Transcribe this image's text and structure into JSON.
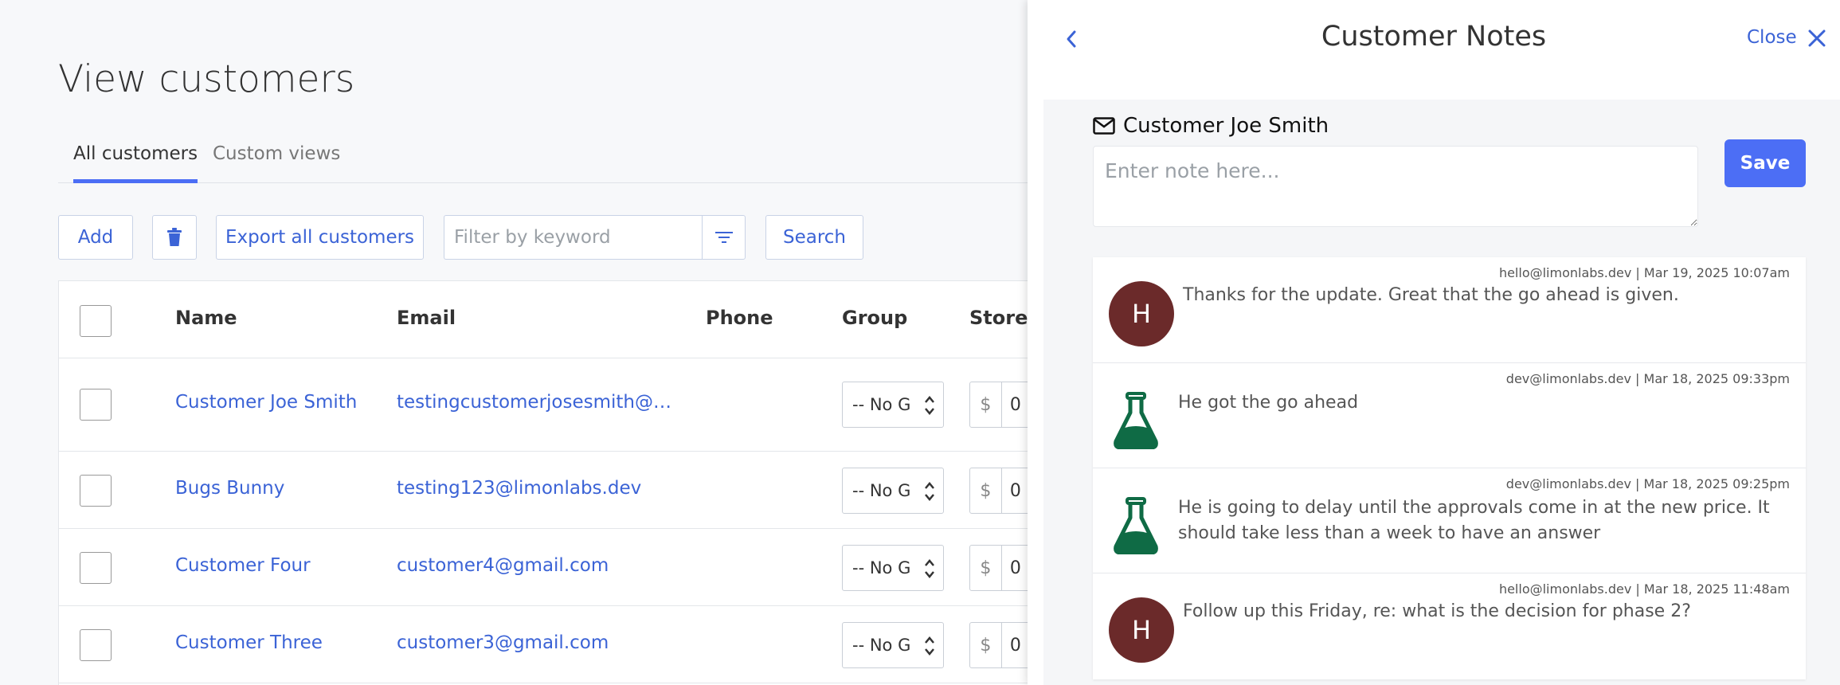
{
  "page": {
    "title": "View customers",
    "tabs": [
      {
        "label": "All customers",
        "active": true
      },
      {
        "label": "Custom views",
        "active": false
      }
    ],
    "toolbar": {
      "add_label": "Add",
      "delete_icon": "trash-icon",
      "export_label": "Export all customers",
      "filter_placeholder": "Filter by keyword",
      "filter_icon": "filter-icon",
      "search_label": "Search"
    },
    "table": {
      "columns": [
        "Name",
        "Email",
        "Phone",
        "Group",
        "Store c"
      ],
      "rows": [
        {
          "name": "Customer Joe Smith",
          "email": "testingcustomerjosesmith@limo...",
          "phone": "",
          "group": "-- No Gr",
          "currency": "$",
          "credit": "0"
        },
        {
          "name": "Bugs Bunny",
          "email": "testing123@limonlabs.dev",
          "phone": "",
          "group": "-- No Gr",
          "currency": "$",
          "credit": "0"
        },
        {
          "name": "Customer Four",
          "email": "customer4@gmail.com",
          "phone": "",
          "group": "-- No Gr",
          "currency": "$",
          "credit": "0"
        },
        {
          "name": "Customer Three",
          "email": "customer3@gmail.com",
          "phone": "",
          "group": "-- No Gr",
          "currency": "$",
          "credit": "0"
        }
      ]
    }
  },
  "notes_panel": {
    "title": "Customer Notes",
    "close_label": "Close",
    "customer_label": "Customer Joe Smith",
    "note_placeholder": "Enter note here...",
    "save_label": "Save",
    "notes": [
      {
        "author": "hello@limonlabs.dev",
        "sep": "|",
        "date": "Mar 19, 2025 10:07am",
        "avatar_type": "initial",
        "initial": "H",
        "text": "Thanks for the update. Great that the go ahead is given."
      },
      {
        "author": "dev@limonlabs.dev",
        "sep": "|",
        "date": "Mar 18, 2025 09:33pm",
        "avatar_type": "flask",
        "initial": "",
        "text": "He got the go ahead"
      },
      {
        "author": "dev@limonlabs.dev",
        "sep": "|",
        "date": "Mar 18, 2025 09:25pm",
        "avatar_type": "flask",
        "initial": "",
        "text": "He is going to delay until the approvals come in at the new price. It should take less than a week to have an answer"
      },
      {
        "author": "hello@limonlabs.dev",
        "sep": "|",
        "date": "Mar 18, 2025 11:48am",
        "avatar_type": "initial",
        "initial": "H",
        "text": "Follow up this Friday, re: what is the decision for phase 2?"
      }
    ]
  },
  "colors": {
    "accent": "#4c6ef5",
    "link": "#3b63d6",
    "avatar_bg": "#6b2a2a",
    "flask": "#0f6b45"
  }
}
